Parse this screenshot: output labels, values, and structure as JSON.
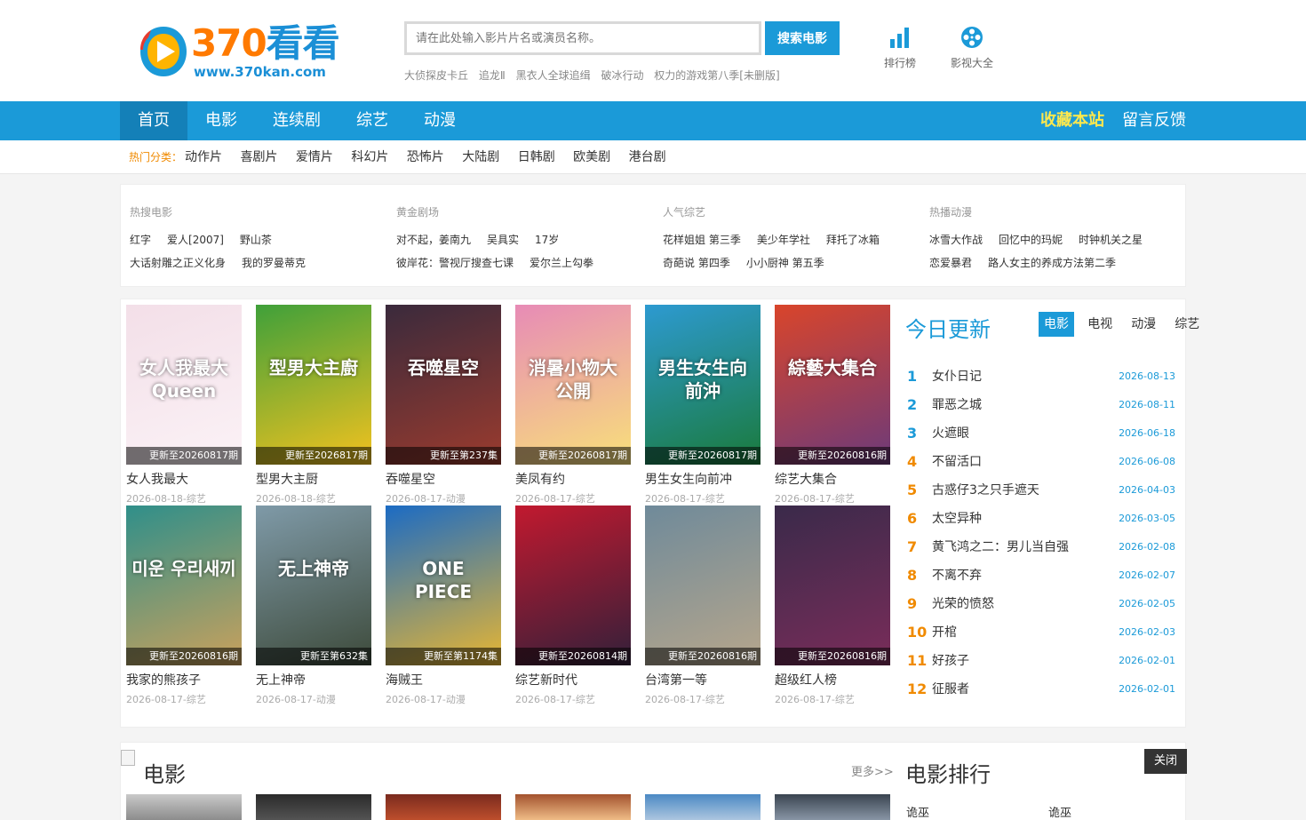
{
  "header": {
    "logo": {
      "brand_num": "370",
      "brand_text": "看看",
      "url": "www.370kan.com"
    },
    "search": {
      "placeholder": "请在此处输入影片片名或演员名称。",
      "button": "搜索电影"
    },
    "hot_words": [
      "大侦探皮卡丘",
      "追龙Ⅱ",
      "黑衣人全球追缉",
      "破冰行动",
      "权力的游戏第八季[未删版]"
    ],
    "tools": [
      {
        "label": "排行榜",
        "icon": "bar-chart-icon"
      },
      {
        "label": "影视大全",
        "icon": "film-reel-icon"
      }
    ]
  },
  "nav": {
    "items": [
      "首页",
      "电影",
      "连续剧",
      "综艺",
      "动漫"
    ],
    "favorite": "收藏本站",
    "feedback": "留言反馈"
  },
  "catbar": {
    "label": "热门分类：",
    "items": [
      "动作片",
      "喜剧片",
      "爱情片",
      "科幻片",
      "恐怖片",
      "大陆剧",
      "日韩剧",
      "欧美剧",
      "港台剧"
    ]
  },
  "hotpanel": [
    {
      "title": "热搜电影",
      "rows": [
        [
          "红字",
          "爱人[2007]",
          "野山茶"
        ],
        [
          "大话射雕之正义化身",
          "我的罗曼蒂克"
        ]
      ]
    },
    {
      "title": "黄金剧场",
      "rows": [
        [
          "对不起，姜南九",
          "吴具实",
          "17岁"
        ],
        [
          "彼岸花：警视厅搜查七课",
          "爱尔兰上勾拳"
        ]
      ]
    },
    {
      "title": "人气综艺",
      "rows": [
        [
          "花样姐姐 第三季",
          "美少年学社",
          "拜托了冰箱"
        ],
        [
          "奇葩说 第四季",
          "小小厨神 第五季"
        ]
      ]
    },
    {
      "title": "热播动漫",
      "rows": [
        [
          "冰雪大作战",
          "回忆中的玛妮",
          "时钟机关之星"
        ],
        [
          "恋爱暴君",
          "路人女主的养成方法第二季"
        ]
      ]
    }
  ],
  "cards": [
    {
      "caption": "更新至20260817期",
      "name": "女人我最大",
      "meta": "2026-08-18-综艺",
      "color1": "#f3dfe8",
      "color2": "#fbf2f6",
      "label": "女人我最大Queen"
    },
    {
      "caption": "更新至2026817期",
      "name": "型男大主厨",
      "meta": "2026-08-18-综艺",
      "color1": "#3fa03a",
      "color2": "#f3c21f",
      "label": "型男大主廚"
    },
    {
      "caption": "更新至第237集",
      "name": "吞噬星空",
      "meta": "2026-08-17-动漫",
      "color1": "#3a2a3c",
      "color2": "#9b3b2e",
      "label": "吞噬星空"
    },
    {
      "caption": "更新至20260817期",
      "name": "美凤有约",
      "meta": "2026-08-17-综艺",
      "color1": "#e78bb6",
      "color2": "#f8e07a",
      "label": "消暑小物大公開"
    },
    {
      "caption": "更新至20260817期",
      "name": "男生女生向前冲",
      "meta": "2026-08-17-综艺",
      "color1": "#2d9ad1",
      "color2": "#1a7a3b",
      "label": "男生女生向前沖"
    },
    {
      "caption": "更新至20260816期",
      "name": "综艺大集合",
      "meta": "2026-08-17-综艺",
      "color1": "#d9452b",
      "color2": "#6c3a7a",
      "label": "綜藝大集合"
    },
    {
      "caption": "更新至20260816期",
      "name": "我家的熊孩子",
      "meta": "2026-08-17-综艺",
      "color1": "#2f8f8a",
      "color2": "#caa15c",
      "label": "미운 우리새끼"
    },
    {
      "caption": "更新至第632集",
      "name": "无上神帝",
      "meta": "2026-08-17-动漫",
      "color1": "#7f9aa8",
      "color2": "#3d4a3a",
      "label": "无上神帝"
    },
    {
      "caption": "更新至第1174集",
      "name": "海贼王",
      "meta": "2026-08-17-动漫",
      "color1": "#1b6bc4",
      "color2": "#e8b632",
      "label": "ONE PIECE"
    },
    {
      "caption": "更新至20260814期",
      "name": "综艺新时代",
      "meta": "2026-08-17-综艺",
      "color1": "#c2192f",
      "color2": "#32203a",
      "label": ""
    },
    {
      "caption": "更新至20260816期",
      "name": "台湾第一等",
      "meta": "2026-08-17-综艺",
      "color1": "#6f8a9a",
      "color2": "#b6a68c",
      "label": ""
    },
    {
      "caption": "更新至20260816期",
      "name": "超级红人榜",
      "meta": "2026-08-17-综艺",
      "color1": "#3a2a4a",
      "color2": "#7a2d5a",
      "label": ""
    }
  ],
  "today": {
    "title": "今日更新",
    "tabs": [
      "电影",
      "电视",
      "动漫",
      "综艺"
    ],
    "items": [
      {
        "n": "1",
        "title": "女仆日记",
        "date": "2026-08-13"
      },
      {
        "n": "2",
        "title": "罪恶之城",
        "date": "2026-08-11"
      },
      {
        "n": "3",
        "title": "火遮眼",
        "date": "2026-06-18"
      },
      {
        "n": "4",
        "title": "不留活口",
        "date": "2026-06-08"
      },
      {
        "n": "5",
        "title": "古惑仔3之只手遮天",
        "date": "2026-04-03"
      },
      {
        "n": "6",
        "title": "太空异种",
        "date": "2026-03-05"
      },
      {
        "n": "7",
        "title": "黄飞鸿之二：男儿当自强",
        "date": "2026-02-08"
      },
      {
        "n": "8",
        "title": "不离不弃",
        "date": "2026-02-07"
      },
      {
        "n": "9",
        "title": "光荣的愤怒",
        "date": "2026-02-05"
      },
      {
        "n": "10",
        "title": "开棺",
        "date": "2026-02-03"
      },
      {
        "n": "11",
        "title": "好孩子",
        "date": "2026-02-01"
      },
      {
        "n": "12",
        "title": "征服者",
        "date": "2026-02-01"
      }
    ]
  },
  "movies": {
    "title": "电影",
    "more": "更多>>",
    "rank_title": "电影排行",
    "close": "关闭",
    "rank_items": [
      "诡巫",
      "诡巫"
    ]
  },
  "colors": {
    "accent": "#1b9ad8",
    "accent_dark": "#1480b8",
    "favorite": "#ffe84d",
    "hot_rank": "#f08a00"
  }
}
